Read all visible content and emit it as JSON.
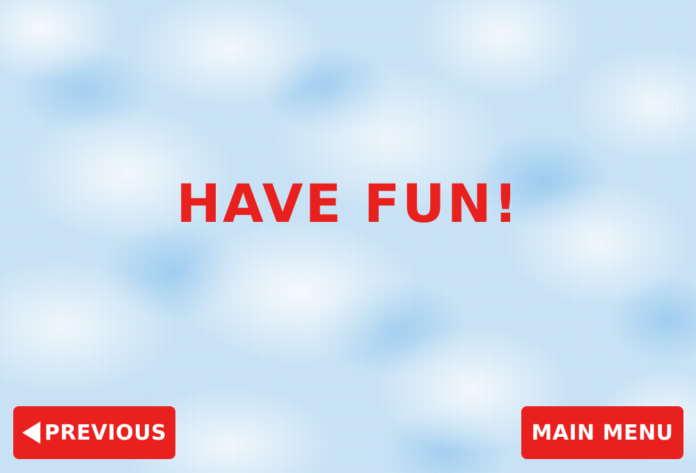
{
  "screen": {
    "headline": "HAVE FUN!"
  },
  "buttons": {
    "previous": {
      "label": "PREVIOUS",
      "icon": "arrow-left-icon"
    },
    "main_menu": {
      "label": "MAIN MENU"
    }
  },
  "colors": {
    "accent_red": "#e8211f",
    "button_text": "#ffffff",
    "sky_blue": "#c8e3f6"
  }
}
